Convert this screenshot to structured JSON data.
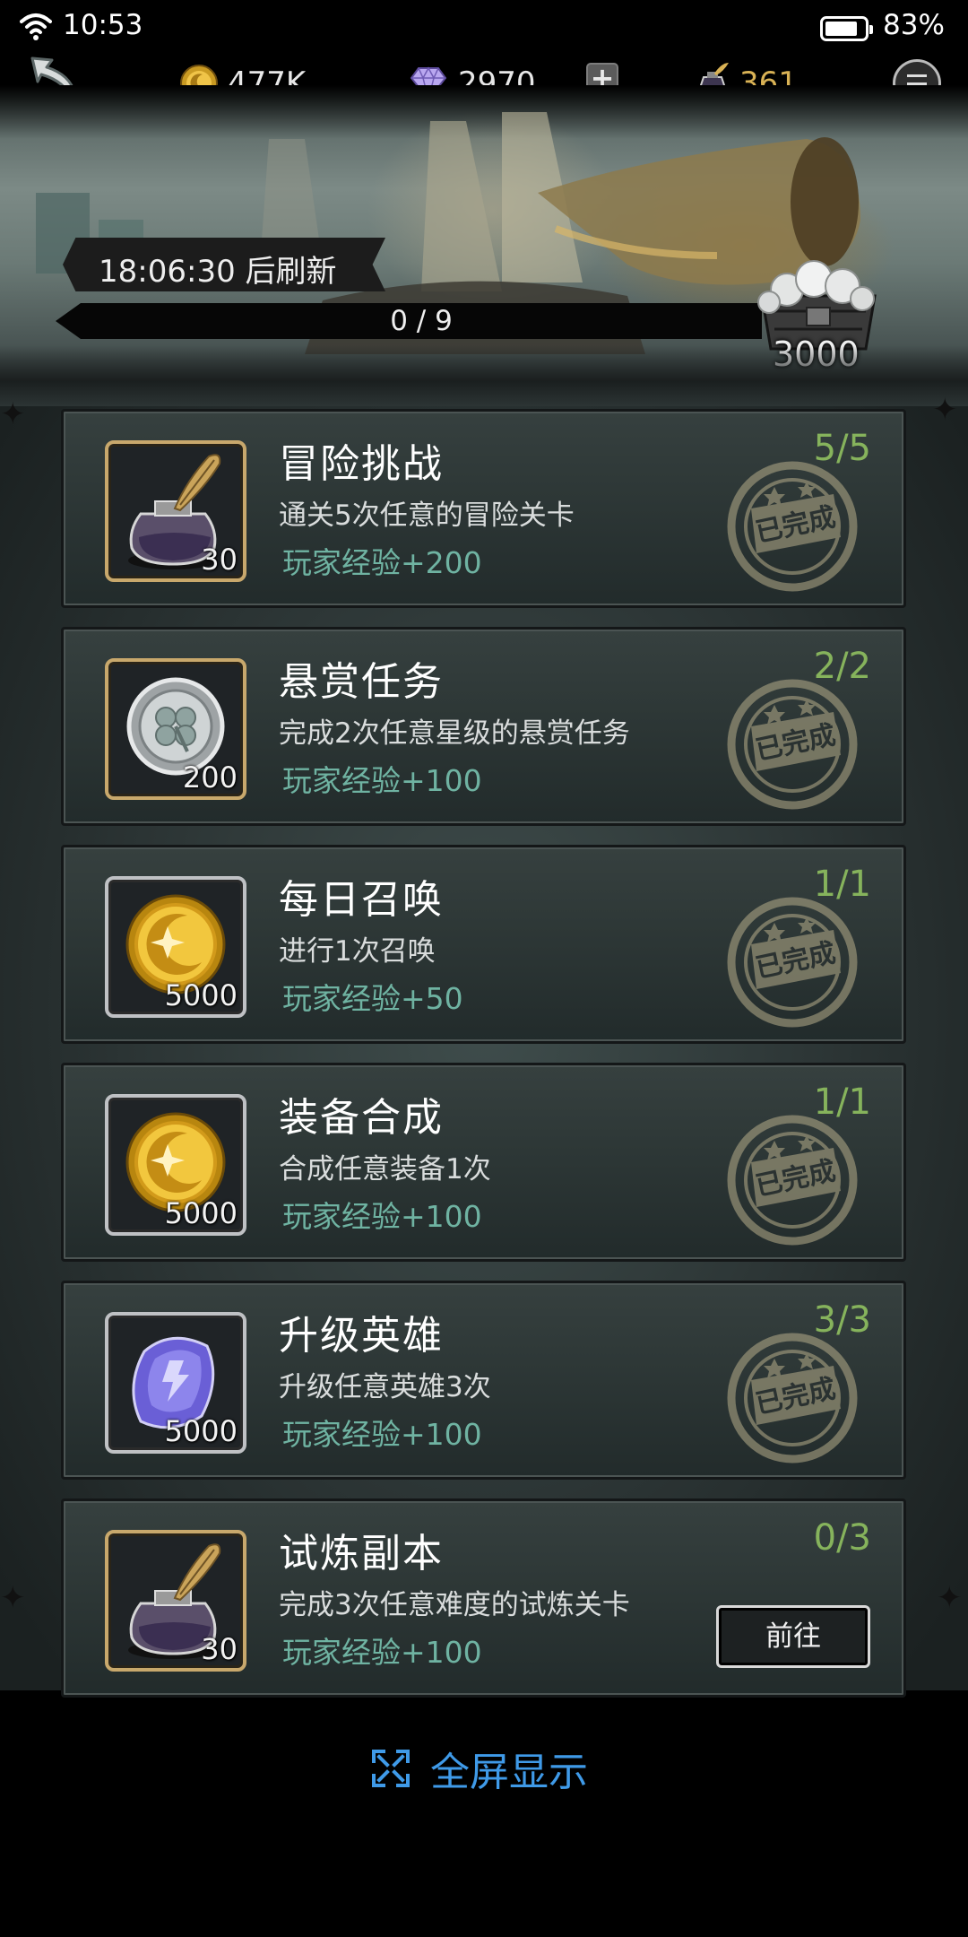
{
  "status_bar": {
    "time": "10:53",
    "battery_pct": "83%",
    "battery_level": 0.83
  },
  "resources": {
    "gold": "477K",
    "gems": "2970",
    "add": "+",
    "ink": "361"
  },
  "banner": {
    "refresh_text": "18:06:30 后刷新",
    "progress_text": "0 / 9",
    "progress_fraction": 0,
    "chest_value": "3000"
  },
  "tasks": [
    {
      "title": "冒险挑战",
      "desc": "通关5次任意的冒险关卡",
      "reward": "玩家经验+200",
      "progress": "5/5",
      "icon": "ink-bottle-icon",
      "icon_count": "30",
      "frame": "gold",
      "status": "已完成"
    },
    {
      "title": "悬赏任务",
      "desc": "完成2次任意星级的悬赏任务",
      "reward": "玩家经验+100",
      "progress": "2/2",
      "icon": "clover-coin-icon",
      "icon_count": "200",
      "frame": "gold",
      "status": "已完成"
    },
    {
      "title": "每日召唤",
      "desc": "进行1次召唤",
      "reward": "玩家经验+50",
      "progress": "1/1",
      "icon": "gold-moon-coin-icon",
      "icon_count": "5000",
      "frame": "silver",
      "status": "已完成"
    },
    {
      "title": "装备合成",
      "desc": "合成任意装备1次",
      "reward": "玩家经验+100",
      "progress": "1/1",
      "icon": "gold-moon-coin-icon",
      "icon_count": "5000",
      "frame": "silver",
      "status": "已完成"
    },
    {
      "title": "升级英雄",
      "desc": "升级任意英雄3次",
      "reward": "玩家经验+100",
      "progress": "3/3",
      "icon": "purple-crystal-icon",
      "icon_count": "5000",
      "frame": "silver",
      "status": "已完成"
    },
    {
      "title": "试炼副本",
      "desc": "完成3次任意难度的试炼关卡",
      "reward": "玩家经验+100",
      "progress": "0/3",
      "icon": "ink-bottle-icon",
      "icon_count": "30",
      "frame": "gold",
      "button": "前往"
    }
  ],
  "fullscreen_label": "全屏显示"
}
